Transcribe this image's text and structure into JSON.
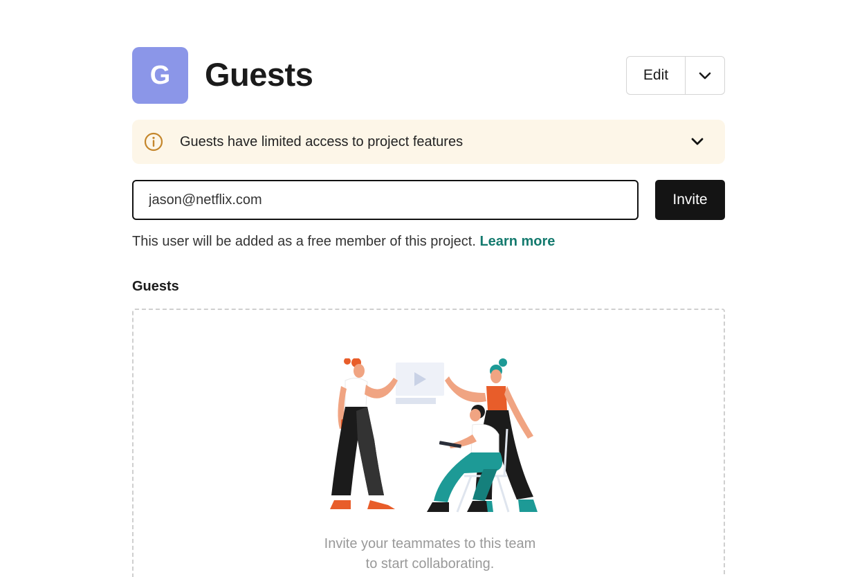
{
  "header": {
    "avatar_letter": "G",
    "title": "Guests",
    "edit_label": "Edit",
    "edit_menu_icon": "chevron-down-icon"
  },
  "banner": {
    "icon": "info-icon",
    "text": "Guests have limited access to project features",
    "expand_icon": "chevron-down-icon",
    "background": "#fdf6e8",
    "icon_color": "#c4862b"
  },
  "invite": {
    "email_value": "jason@netflix.com",
    "button_label": "Invite"
  },
  "helper": {
    "text": "This user will be added as a free member of this project.",
    "link": "Learn more",
    "link_color": "#147a6e"
  },
  "guests_section": {
    "label": "Guests",
    "empty_line1": "Invite your teammates to this team",
    "empty_line2": "to start collaborating."
  },
  "colors": {
    "avatar": "#8b96e8",
    "primary_button": "#141414"
  }
}
